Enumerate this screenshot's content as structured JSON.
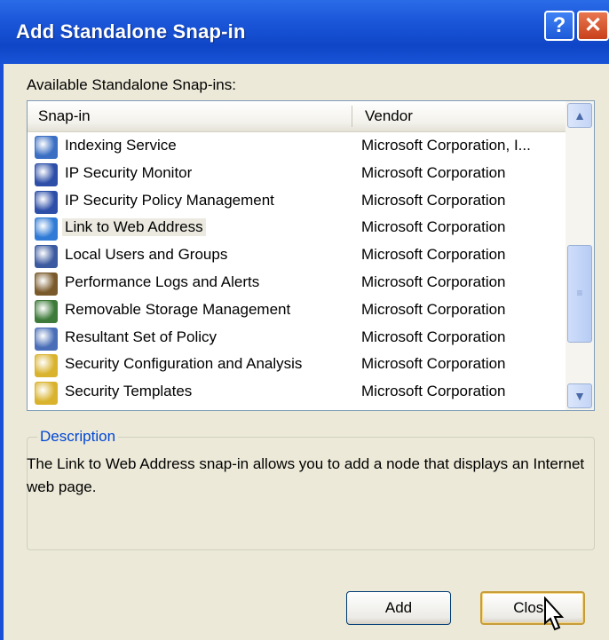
{
  "dialog": {
    "title": "Add Standalone Snap-in",
    "help_glyph": "?",
    "close_glyph": "✕"
  },
  "list": {
    "label": "Available Standalone Snap-ins:",
    "columns": [
      "Snap-in",
      "Vendor"
    ],
    "scroll_up_glyph": "▲",
    "scroll_down_glyph": "▼",
    "scroll_thumb_glyph": "≡",
    "items": [
      {
        "name": "Indexing Service",
        "vendor": "Microsoft Corporation, I...",
        "icon": "indexing-service-icon",
        "color": "#3a6fc4"
      },
      {
        "name": "IP Security Monitor",
        "vendor": "Microsoft Corporation",
        "icon": "ip-security-monitor-icon",
        "color": "#2d4fa8"
      },
      {
        "name": "IP Security Policy Management",
        "vendor": "Microsoft Corporation",
        "icon": "ip-security-policy-icon",
        "color": "#2d4fa8"
      },
      {
        "name": "Link to Web Address",
        "vendor": "Microsoft Corporation",
        "icon": "web-address-icon",
        "color": "#2f7bd6"
      },
      {
        "name": "Local Users and Groups",
        "vendor": "Microsoft Corporation",
        "icon": "users-groups-icon",
        "color": "#3b5aa0"
      },
      {
        "name": "Performance Logs and Alerts",
        "vendor": "Microsoft Corporation",
        "icon": "performance-logs-icon",
        "color": "#7a5a2a"
      },
      {
        "name": "Removable Storage Management",
        "vendor": "Microsoft Corporation",
        "icon": "removable-storage-icon",
        "color": "#3e7b3a"
      },
      {
        "name": "Resultant Set of Policy",
        "vendor": "Microsoft Corporation",
        "icon": "resultant-policy-icon",
        "color": "#4a6fb8"
      },
      {
        "name": "Security Configuration and Analysis",
        "vendor": "Microsoft Corporation",
        "icon": "security-config-icon",
        "color": "#d9b32e"
      },
      {
        "name": "Security Templates",
        "vendor": "Microsoft Corporation",
        "icon": "security-templates-icon",
        "color": "#d9b32e"
      }
    ],
    "selected_index": 3
  },
  "description": {
    "title": "Description",
    "text": "The Link to Web Address snap-in allows you to add a node that displays an Internet web page."
  },
  "buttons": {
    "add": "Add",
    "close": "Close"
  }
}
